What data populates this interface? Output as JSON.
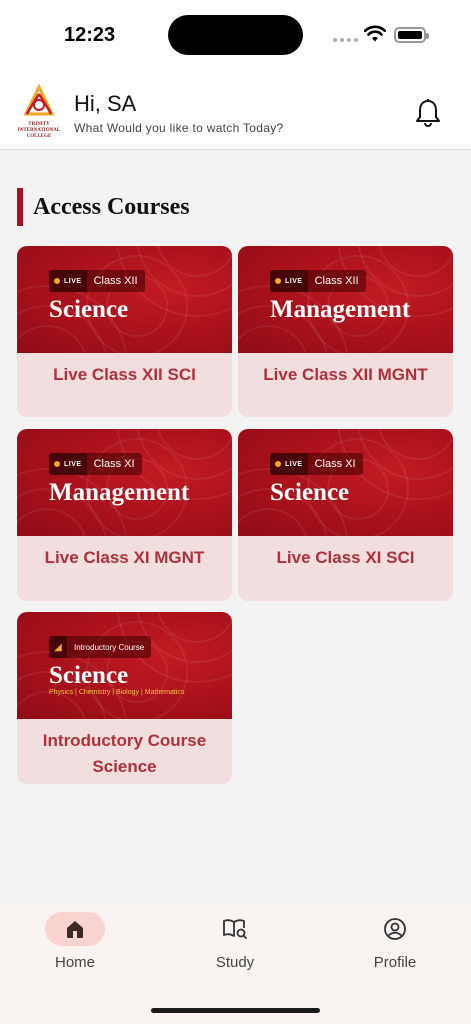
{
  "status_bar": {
    "time": "12:23"
  },
  "header": {
    "logo_text": "TRINITY INTERNATIONAL COLLEGE",
    "greeting": "Hi, SA",
    "subtitle": "What Would you like to watch Today?"
  },
  "section": {
    "title": "Access Courses"
  },
  "courses": [
    {
      "badge": "LIVE",
      "class_label": "Class XII",
      "banner_title": "Science",
      "label": "Live Class XII SCI"
    },
    {
      "badge": "LIVE",
      "class_label": "Class XII",
      "banner_title": "Management",
      "label": "Live Class XII MGNT"
    },
    {
      "badge": "LIVE",
      "class_label": "Class XI",
      "banner_title": "Management",
      "label": "Live Class XI MGNT"
    },
    {
      "badge": "LIVE",
      "class_label": "Class XI",
      "banner_title": "Science",
      "label": "Live Class XI SCI"
    },
    {
      "pill_label": "Introductory Course",
      "banner_title": "Science",
      "banner_subjects": "Physics | Chemistry | Biology | Mathematics",
      "label_line1": "Introductory Course",
      "label_line2": "Science"
    }
  ],
  "bottom_nav": {
    "items": [
      {
        "label": "Home",
        "icon": "home-icon",
        "active": true
      },
      {
        "label": "Study",
        "icon": "book-search-icon",
        "active": false
      },
      {
        "label": "Profile",
        "icon": "user-circle-icon",
        "active": false
      }
    ]
  },
  "colors": {
    "brand_red": "#a5151f",
    "card_bg": "#f2dede",
    "label_red": "#b0313c",
    "nav_active": "#f9d3cf"
  }
}
